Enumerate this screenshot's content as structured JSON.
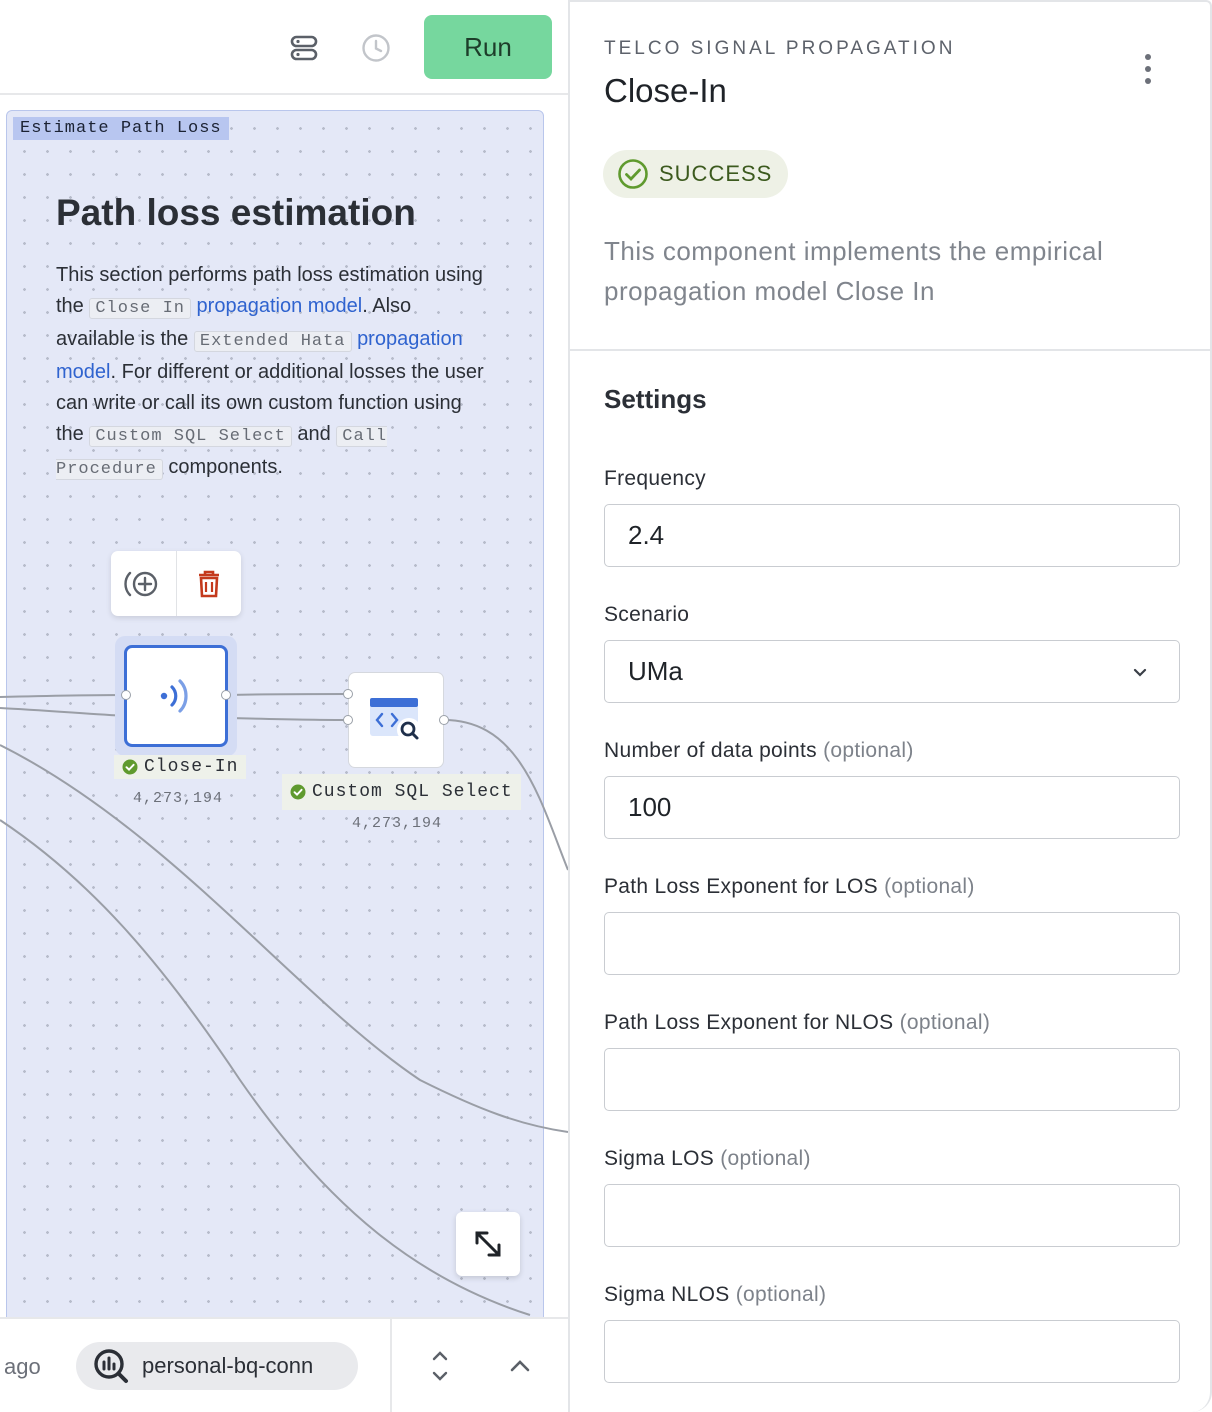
{
  "toolbar": {
    "run_label": "Run",
    "layers_icon": "layers-icon",
    "history_icon": "clock-icon",
    "run_color": "#76d79e"
  },
  "canvas": {
    "group_tag": "Estimate Path Loss",
    "note": {
      "title": "Path loss estimation",
      "p1": "This section performs path loss estimation using the ",
      "code_close_in": "Close In",
      "link1": "propagation model",
      "p2": ". Also available is the ",
      "code_extended_hata": "Extended Hata",
      "link2": "propagation model",
      "p3": ". For different or additional losses the user can write or call its own custom function using the ",
      "code_custom_sql": "Custom SQL Select",
      "p4": " and ",
      "code_call_procedure": "Call Procedure",
      "p5": " components."
    },
    "nodes": {
      "close_in": {
        "label": "Close-In",
        "count": "4,273,194",
        "icon": "signal-icon"
      },
      "custom_sql": {
        "label": "Custom SQL Select",
        "count": "4,273,194",
        "icon": "code-search-icon"
      }
    }
  },
  "bottombar": {
    "ago": "ago",
    "connection": "personal-bq-conn"
  },
  "panel": {
    "eyebrow": "TELCO SIGNAL PROPAGATION",
    "title": "Close-In",
    "status": "SUCCESS",
    "status_color": "#5f9a2e",
    "description": "This component implements the empirical propagation model Close In",
    "settings_heading": "Settings",
    "optional": "(optional)",
    "fields": {
      "frequency": {
        "label": "Frequency",
        "value": "2.4"
      },
      "scenario": {
        "label": "Scenario",
        "value": "UMa"
      },
      "data_points": {
        "label": "Number of data points",
        "value": "100"
      },
      "ple_los": {
        "label": "Path Loss Exponent for LOS",
        "value": ""
      },
      "ple_nlos": {
        "label": "Path Loss Exponent for NLOS",
        "value": ""
      },
      "sigma_los": {
        "label": "Sigma LOS",
        "value": ""
      },
      "sigma_nlos": {
        "label": "Sigma NLOS",
        "value": ""
      }
    }
  }
}
